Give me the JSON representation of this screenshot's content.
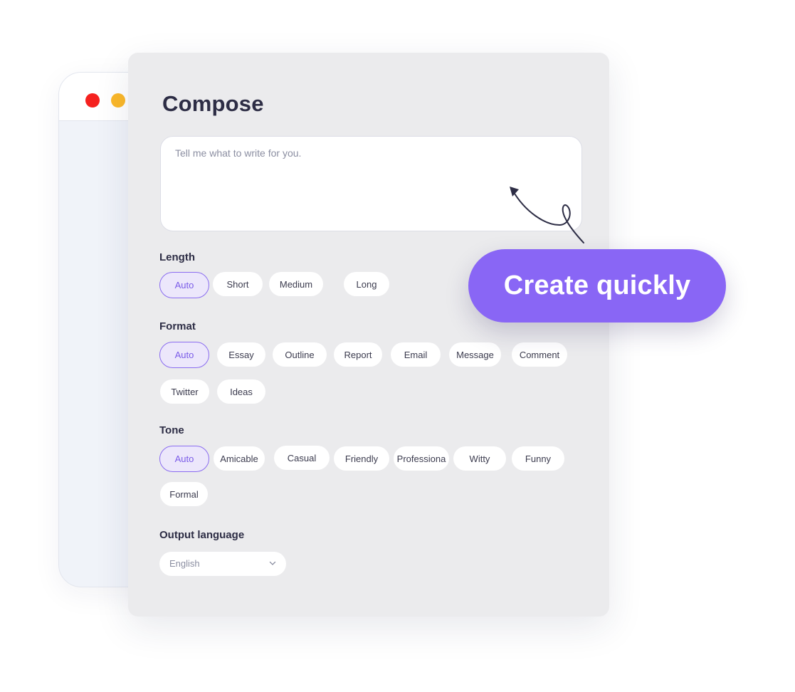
{
  "compose": {
    "title": "Compose",
    "prompt_placeholder": "Tell me what to write for you."
  },
  "length": {
    "label": "Length",
    "options": [
      "Auto",
      "Short",
      "Medium",
      "Long"
    ],
    "selected": "Auto"
  },
  "format": {
    "label": "Format",
    "options": [
      "Auto",
      "Essay",
      "Outline",
      "Report",
      "Email",
      "Message",
      "Comment",
      "Twitter",
      "Ideas"
    ],
    "selected": "Auto"
  },
  "tone": {
    "label": "Tone",
    "options": [
      "Auto",
      "Amicable",
      "Casual",
      "Friendly",
      "Professiona",
      "Witty",
      "Funny",
      "Formal"
    ],
    "selected": "Auto"
  },
  "output_language": {
    "label": "Output language",
    "value": "English"
  },
  "cta": {
    "label": "Create quickly"
  },
  "colors": {
    "accent": "#8966f5",
    "accent_light": "#ece7fb",
    "panel_bg": "#ebebed",
    "window_close": "#f5211f",
    "window_minimize": "#fbb829"
  },
  "icons": {
    "select_caret": "chevron-down-icon",
    "annotation_arrow": "curly-arrow-icon"
  }
}
